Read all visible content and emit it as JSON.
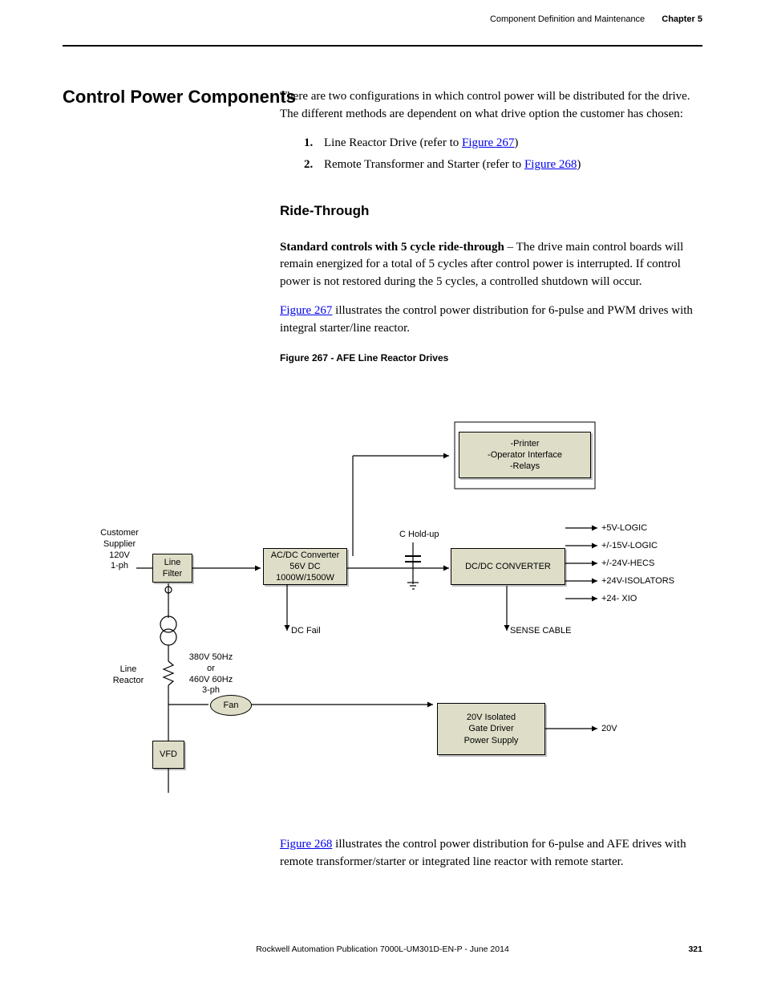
{
  "header": {
    "section": "Component Definition and Maintenance",
    "chapter": "Chapter 5"
  },
  "section_title": "Control Power Components",
  "intro": "There are two configurations in which control power will be distributed for the drive. The different methods are dependent on what drive option the customer has chosen:",
  "list": {
    "n1": "1.",
    "i1_pre": "Line Reactor Drive (refer to ",
    "i1_link": "Figure 267",
    "i1_post": ")",
    "n2": "2.",
    "i2_pre": "Remote Transformer and Starter (refer to ",
    "i2_link": "Figure 268",
    "i2_post": ")"
  },
  "subhead": "Ride-Through",
  "ride_bold": "Standard controls with 5 cycle ride-through",
  "ride_p": " – The drive main control boards will remain energized for a total of 5 cycles after control power is interrupted. If control power is not restored during the 5 cycles, a controlled shutdown will occur.",
  "fig267_link": "Figure 267",
  "fig267_p": " illustrates the control power distribution for 6-pulse and PWM drives with integral starter/line reactor.",
  "fig267_caption": "Figure 267 - AFE Line Reactor Drives",
  "fig268_link": "Figure 268",
  "fig268_p": " illustrates the control power distribution for 6-pulse and AFE drives with remote transformer/starter or integrated line reactor with remote starter.",
  "footer": {
    "pub": "Rockwell Automation Publication 7000L-UM301D-EN-P - June 2014",
    "page": "321"
  },
  "diagram": {
    "customer": "Customer\nSupplier\n120V\n1-ph",
    "line_filter": "Line\nFilter",
    "acdc": "AC/DC Converter\n56V DC\n1000W/1500W",
    "dcdc": "DC/DC CONVERTER",
    "printer": "-Printer\n-Operator Interface\n-Relays",
    "gate": "20V Isolated\nGate Driver\nPower Supply",
    "vfd": "VFD",
    "fan": "Fan",
    "line_reactor": "Line\nReactor",
    "voltage": "380V 50Hz\nor\n460V 60Hz\n3-ph",
    "c_holdup": "C Hold-up",
    "dc_fail": "DC Fail",
    "sense": "SENSE CABLE",
    "out1": "+5V-LOGIC",
    "out2": "+/-15V-LOGIC",
    "out3": "+/-24V-HECS",
    "out4": "+24V-ISOLATORS",
    "out5": "+24-  XIO",
    "out_20v": "20V"
  }
}
